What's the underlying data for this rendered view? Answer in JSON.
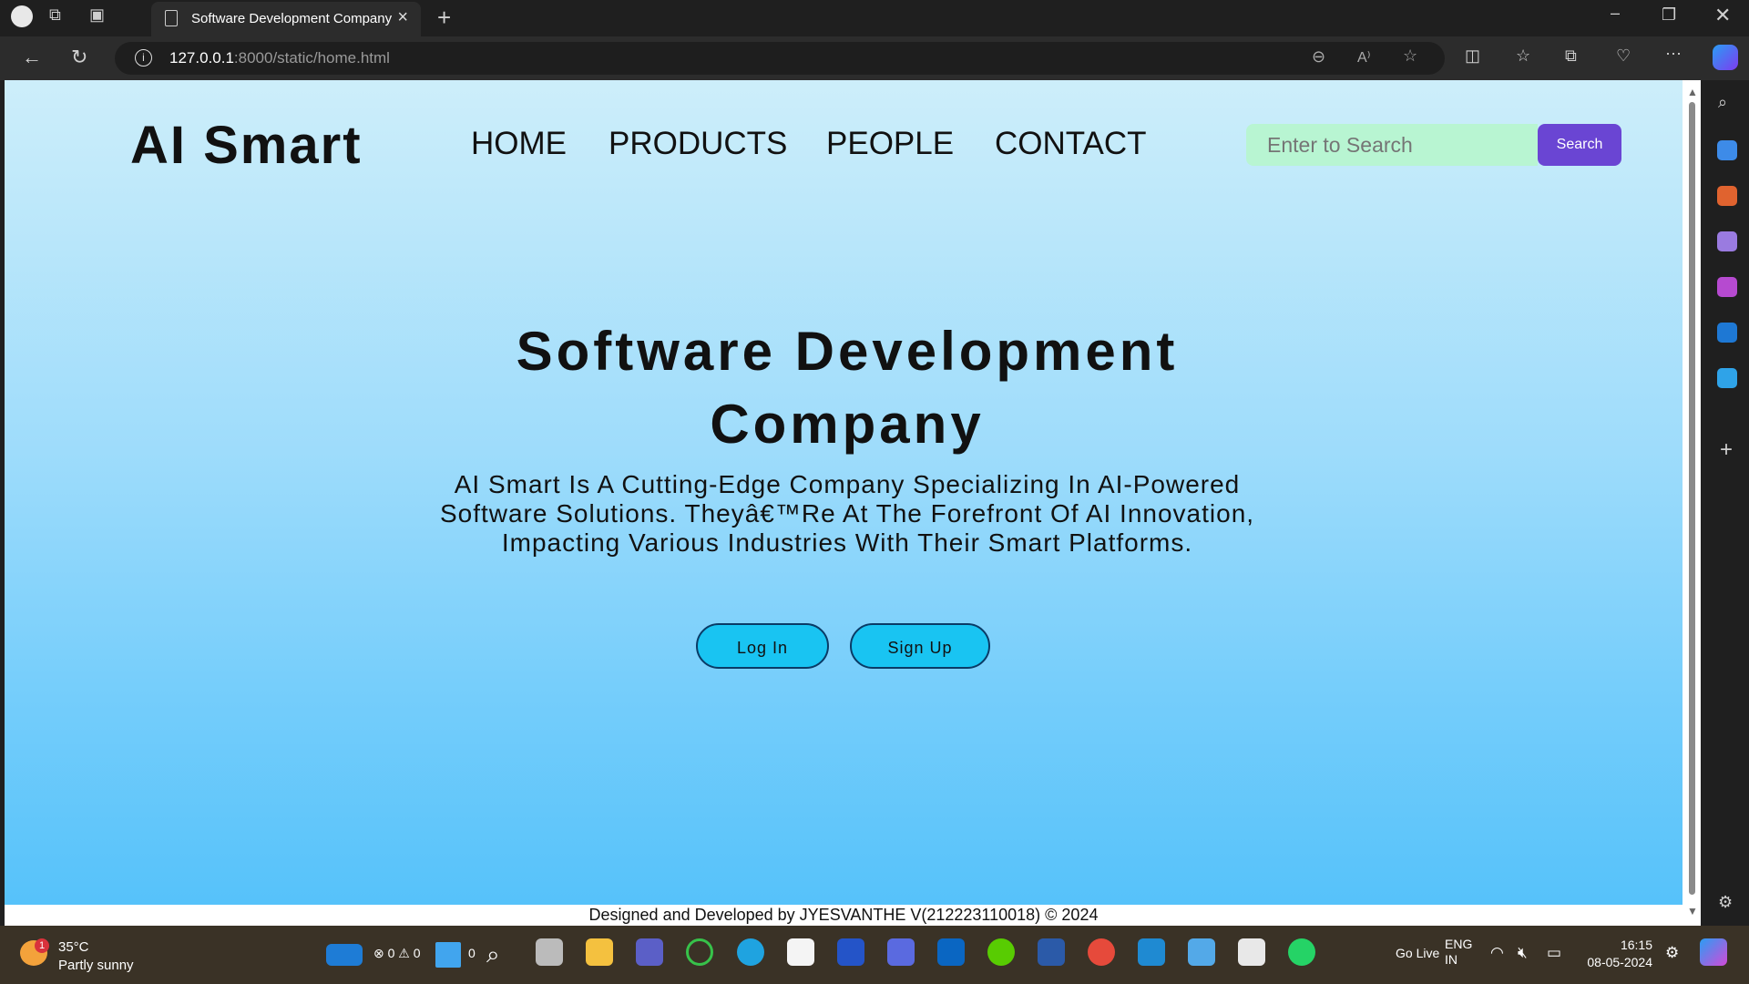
{
  "browser": {
    "tab_title": "Software Development Company",
    "url_host": "127.0.0.1",
    "url_path": ":8000/static/home.html"
  },
  "site": {
    "logo": "AI Smart",
    "nav": [
      "HOME",
      "PRODUCTS",
      "PEOPLE",
      "CONTACT"
    ],
    "search_placeholder": "Enter to Search",
    "search_button": "Search"
  },
  "hero": {
    "title_line1": "Software Development",
    "title_line2": "Company",
    "description": "AI Smart Is A Cutting-Edge Company Specializing In AI-Powered Software Solutions. Theyâ€™Re At The Forefront Of AI Innovation, Impacting Various Industries With Their Smart Platforms.",
    "login_label": "Log In",
    "signup_label": "Sign Up"
  },
  "footer": {
    "credit": "Designed and Developed by JYESVANTHE V(212223110018) © 2024"
  },
  "taskbar": {
    "weather_temp": "35°C",
    "weather_desc": "Partly sunny",
    "weather_badge": "1",
    "problems_text": "⊗ 0 ⚠ 0",
    "ports_text": "0",
    "golive": "Go Live",
    "lang_line1": "ENG",
    "lang_line2": "IN",
    "time": "16:15",
    "date": "08-05-2024"
  },
  "colors": {
    "search_bg": "#b8f5d2",
    "search_button": "#6a45d3",
    "hero_button": "#19c4f2",
    "gradient_top": "#cdeefa",
    "gradient_bottom": "#56c2fa"
  }
}
